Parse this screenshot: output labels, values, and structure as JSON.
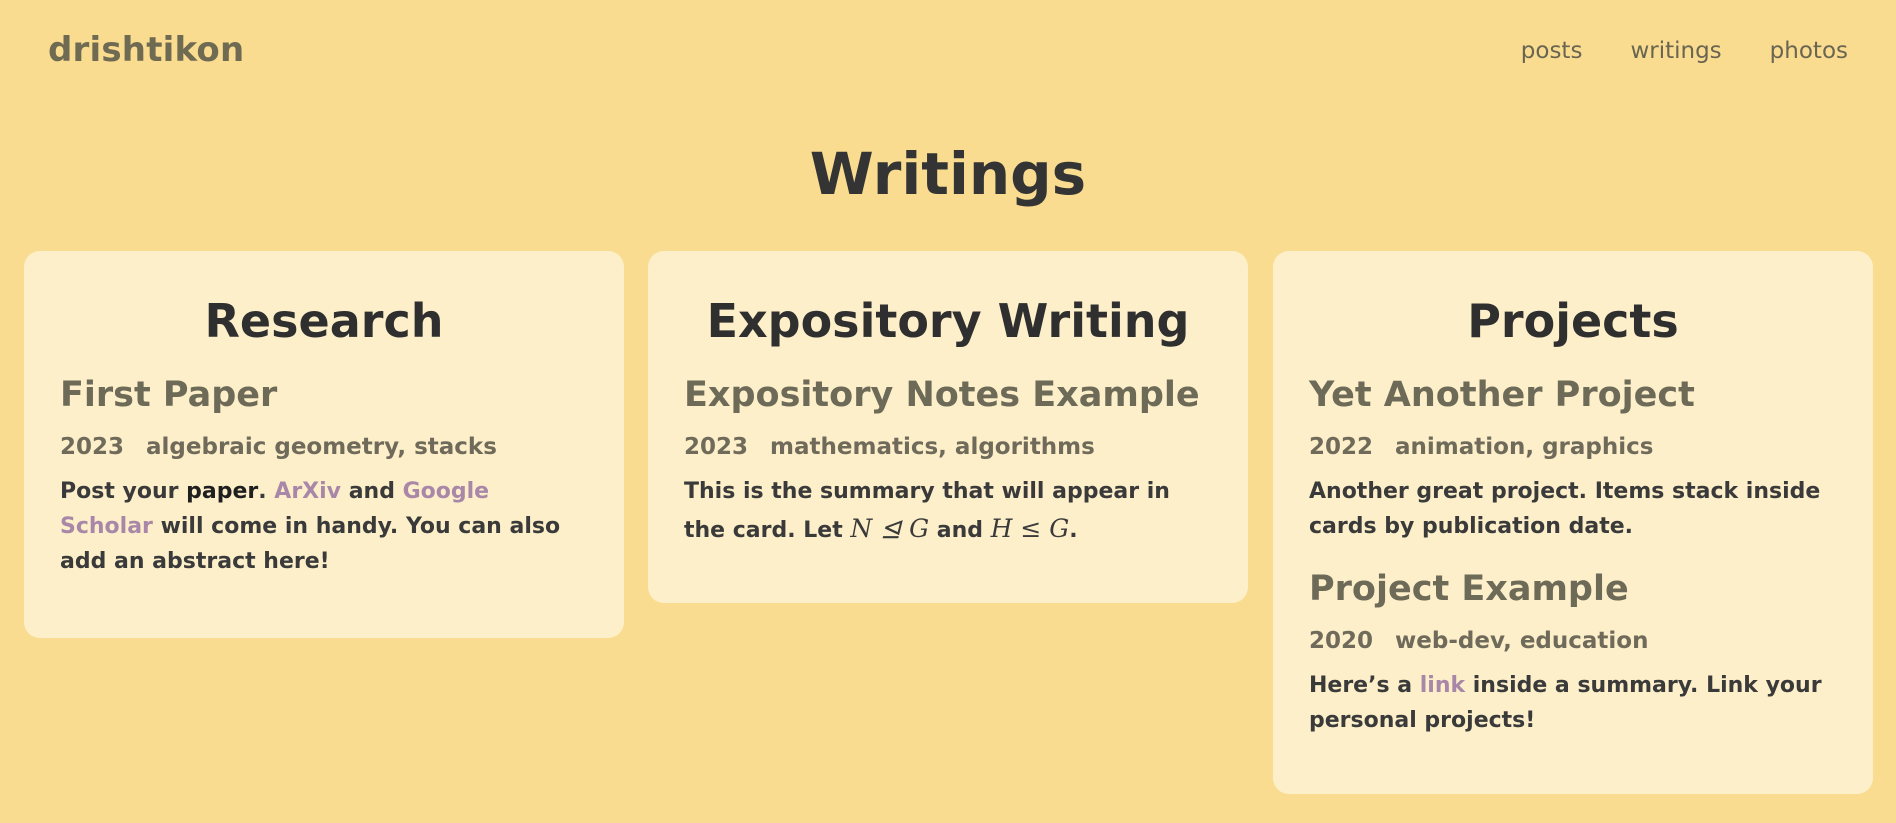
{
  "site": {
    "brand": "drishtikon",
    "nav": [
      "posts",
      "writings",
      "photos"
    ]
  },
  "page": {
    "title": "Writings"
  },
  "sections": [
    {
      "title": "Research",
      "entries": [
        {
          "title": "First Paper",
          "year": "2023",
          "tags": "algebraic geometry, stacks",
          "summary_parts": {
            "t1": "Post your ",
            "bold": "paper",
            "t2": ". ",
            "link1": "ArXiv",
            "t3": " and ",
            "link2": "Google Scholar",
            "t4": " will come in handy. You can also add an abstract here!"
          }
        }
      ]
    },
    {
      "title": "Expository Writing",
      "entries": [
        {
          "title": "Expository Notes Example",
          "year": "2023",
          "tags": "mathematics, algorithms",
          "summary_parts": {
            "t1": "This is the summary that will appear in the card. Let ",
            "m1": "N ⊴ G",
            "t2": " and ",
            "m2": "H ≤ G",
            "t3": "."
          }
        }
      ]
    },
    {
      "title": "Projects",
      "entries": [
        {
          "title": "Yet Another Project",
          "year": "2022",
          "tags": "animation, graphics",
          "summary": "Another great project. Items stack inside cards by publication date."
        },
        {
          "title": "Project Example",
          "year": "2020",
          "tags": "web-dev, education",
          "summary_parts": {
            "t1": "Here’s a ",
            "link": "link",
            "t2": " inside a summary. Link your personal projects!"
          }
        }
      ]
    }
  ],
  "colors": {
    "background": "#f9dc8f",
    "card": "#fcefc9",
    "link": "#a987a8"
  }
}
